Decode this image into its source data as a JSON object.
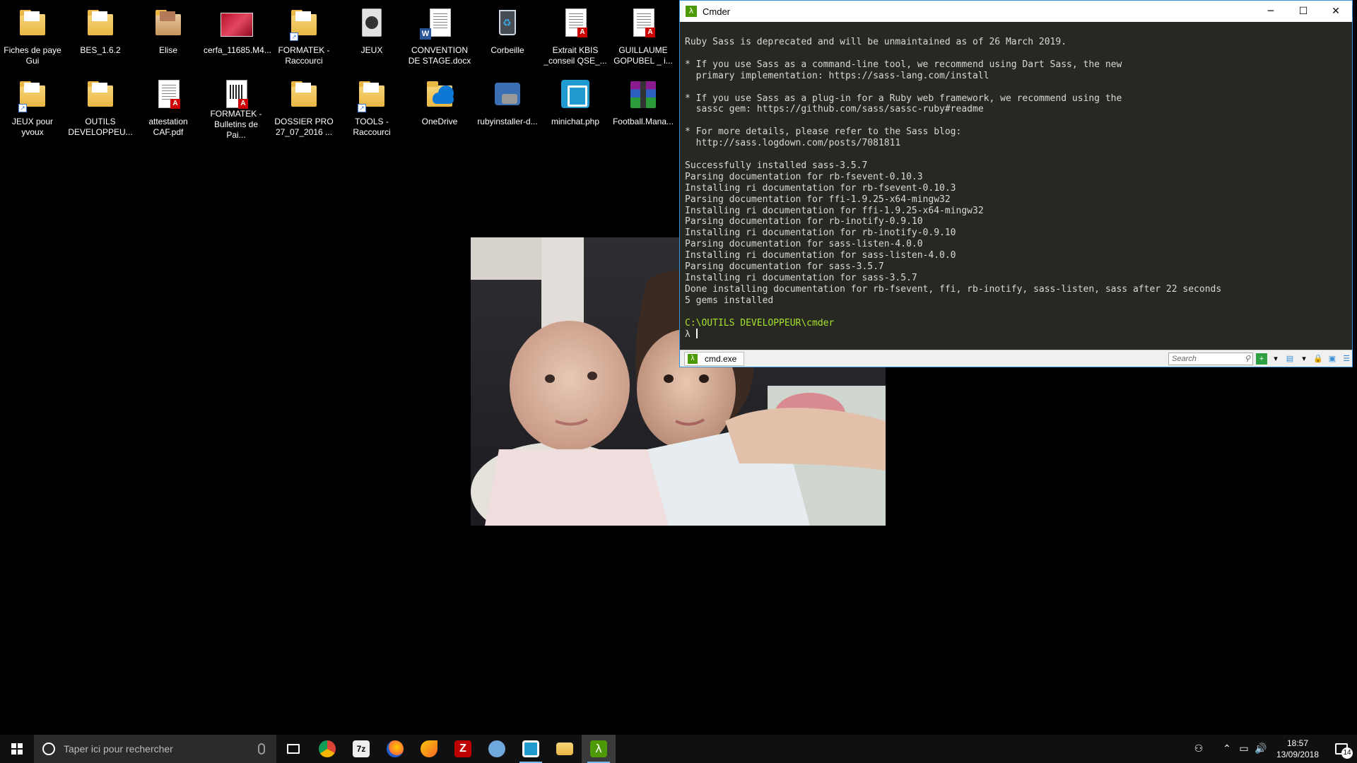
{
  "desktop": {
    "icons_row1": [
      {
        "label": "Fiches de paye Gui",
        "type": "folder"
      },
      {
        "label": "BES_1.6.2",
        "type": "folder"
      },
      {
        "label": "Elise",
        "type": "folder-photo"
      },
      {
        "label": "cerfa_11685.M4...",
        "type": "image"
      },
      {
        "label": "FORMATEK - Raccourci",
        "type": "folder-shortcut"
      },
      {
        "label": "JEUX",
        "type": "disc"
      },
      {
        "label": "CONVENTION DE STAGE.docx",
        "type": "word"
      },
      {
        "label": "Corbeille",
        "type": "recycle-bin"
      },
      {
        "label": "Extrait KBIS _conseil QSE_...",
        "type": "pdf"
      },
      {
        "label": "GUILLAUME GOPUBEL _ i...",
        "type": "pdf"
      }
    ],
    "icons_row2": [
      {
        "label": "JEUX pour yvoux",
        "type": "folder-shortcut"
      },
      {
        "label": "OUTILS DEVELOPPEU...",
        "type": "folder"
      },
      {
        "label": "attestation CAF.pdf",
        "type": "pdf"
      },
      {
        "label": "FORMATEK - Bulletins de Pai...",
        "type": "barcode-pdf"
      },
      {
        "label": "DOSSIER PRO 27_07_2016 ...",
        "type": "folder"
      },
      {
        "label": "TOOLS - Raccourci",
        "type": "folder-shortcut"
      },
      {
        "label": "OneDrive",
        "type": "onedrive"
      },
      {
        "label": "rubyinstaller-d...",
        "type": "installer"
      },
      {
        "label": "minichat.php",
        "type": "brackets"
      },
      {
        "label": "Football.Mana...",
        "type": "winrar"
      }
    ]
  },
  "cmder": {
    "title": "Cmder",
    "controls": {
      "minimize": "─",
      "maximize": "☐",
      "close": "✕"
    },
    "output": [
      "Ruby Sass is deprecated and will be unmaintained as of 26 March 2019.",
      "",
      "* If you use Sass as a command-line tool, we recommend using Dart Sass, the new",
      "  primary implementation: https://sass-lang.com/install",
      "",
      "* If you use Sass as a plug-in for a Ruby web framework, we recommend using the",
      "  sassc gem: https://github.com/sass/sassc-ruby#readme",
      "",
      "* For more details, please refer to the Sass blog:",
      "  http://sass.logdown.com/posts/7081811",
      "",
      "Successfully installed sass-3.5.7",
      "Parsing documentation for rb-fsevent-0.10.3",
      "Installing ri documentation for rb-fsevent-0.10.3",
      "Parsing documentation for ffi-1.9.25-x64-mingw32",
      "Installing ri documentation for ffi-1.9.25-x64-mingw32",
      "Parsing documentation for rb-inotify-0.9.10",
      "Installing ri documentation for rb-inotify-0.9.10",
      "Parsing documentation for sass-listen-4.0.0",
      "Installing ri documentation for sass-listen-4.0.0",
      "Parsing documentation for sass-3.5.7",
      "Installing ri documentation for sass-3.5.7",
      "Done installing documentation for rb-fsevent, ffi, rb-inotify, sass-listen, sass after 22 seconds",
      "5 gems installed",
      ""
    ],
    "prompt_path": "C:\\OUTILS DEVELOPPEUR\\cmder",
    "prompt_symbol": "λ",
    "tab_label": "cmd.exe",
    "search_placeholder": "Search"
  },
  "taskbar": {
    "search_placeholder": "Taper ici pour rechercher",
    "apps": [
      "task-view",
      "chrome",
      "7zip",
      "firefox",
      "sketchbook",
      "filezilla",
      "rubyinstaller",
      "brackets",
      "file-explorer",
      "cmder"
    ],
    "time": "18:57",
    "date": "13/09/2018",
    "notification_count": "14"
  },
  "colors": {
    "terminal_bg": "#272822",
    "prompt_green": "#a6e22e",
    "window_border": "#3b8fd6"
  }
}
